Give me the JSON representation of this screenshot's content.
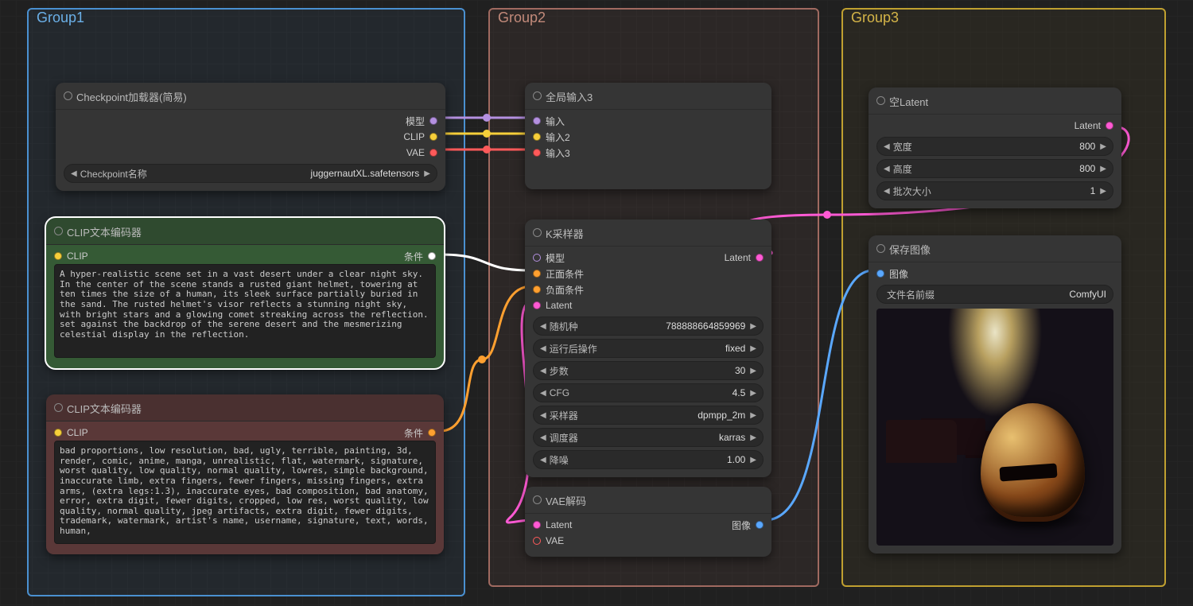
{
  "groups": {
    "g1": "Group1",
    "g2": "Group2",
    "g3": "Group3"
  },
  "checkpoint": {
    "title": "Checkpoint加载器(简易)",
    "out_model": "模型",
    "out_clip": "CLIP",
    "out_vae": "VAE",
    "widget_label": "Checkpoint名称",
    "widget_value": "juggernautXL.safetensors"
  },
  "clip_pos": {
    "title": "CLIP文本编码器",
    "in": "CLIP",
    "out": "条件",
    "text": "A hyper-realistic scene set in a vast desert under a clear night sky. In the center of the scene stands a rusted giant helmet, towering at ten times the size of a human, its sleek surface partially buried in the sand. The rusted helmet's visor reflects a stunning night sky, with bright stars and a glowing comet streaking across the reflection. set against the backdrop of the serene desert and the mesmerizing celestial display in the reflection."
  },
  "clip_neg": {
    "title": "CLIP文本编码器",
    "in": "CLIP",
    "out": "条件",
    "text": "bad proportions, low resolution, bad, ugly, terrible, painting, 3d, render, comic, anime, manga, unrealistic, flat, watermark, signature, worst quality, low quality, normal quality, lowres, simple background, inaccurate limb, extra fingers, fewer fingers, missing fingers, extra arms, (extra legs:1.3), inaccurate eyes, bad composition, bad anatomy, error, extra digit, fewer digits, cropped, low res, worst quality, low quality, normal quality, jpeg artifacts, extra digit, fewer digits, trademark, watermark, artist's name, username, signature, text, words, human,"
  },
  "global_in": {
    "title": "全局输入3",
    "s1": "输入",
    "s2": "输入2",
    "s3": "输入3"
  },
  "ksampler": {
    "title": "K采样器",
    "in_model": "模型",
    "in_pos": "正面条件",
    "in_neg": "负面条件",
    "in_latent": "Latent",
    "out_latent": "Latent",
    "w": [
      {
        "l": "随机种",
        "v": "788888664859969"
      },
      {
        "l": "运行后操作",
        "v": "fixed"
      },
      {
        "l": "步数",
        "v": "30"
      },
      {
        "l": "CFG",
        "v": "4.5"
      },
      {
        "l": "采样器",
        "v": "dpmpp_2m"
      },
      {
        "l": "调度器",
        "v": "karras"
      },
      {
        "l": "降噪",
        "v": "1.00"
      }
    ]
  },
  "vae_decode": {
    "title": "VAE解码",
    "in_latent": "Latent",
    "in_vae": "VAE",
    "out_img": "图像"
  },
  "empty_latent": {
    "title": "空Latent",
    "out": "Latent",
    "w": [
      {
        "l": "宽度",
        "v": "800"
      },
      {
        "l": "高度",
        "v": "800"
      },
      {
        "l": "批次大小",
        "v": "1"
      }
    ]
  },
  "save_image": {
    "title": "保存图像",
    "in": "图像",
    "widget_label": "文件名前缀",
    "widget_value": "ComfyUI"
  },
  "colors": {
    "model": "#b490e0",
    "clip": "#f7cf3a",
    "vae": "#ff5a5a",
    "cond_white": "#ffffff",
    "cond_orange": "#ffa030",
    "latent": "#ff5ad4",
    "image": "#5aa8ff"
  }
}
